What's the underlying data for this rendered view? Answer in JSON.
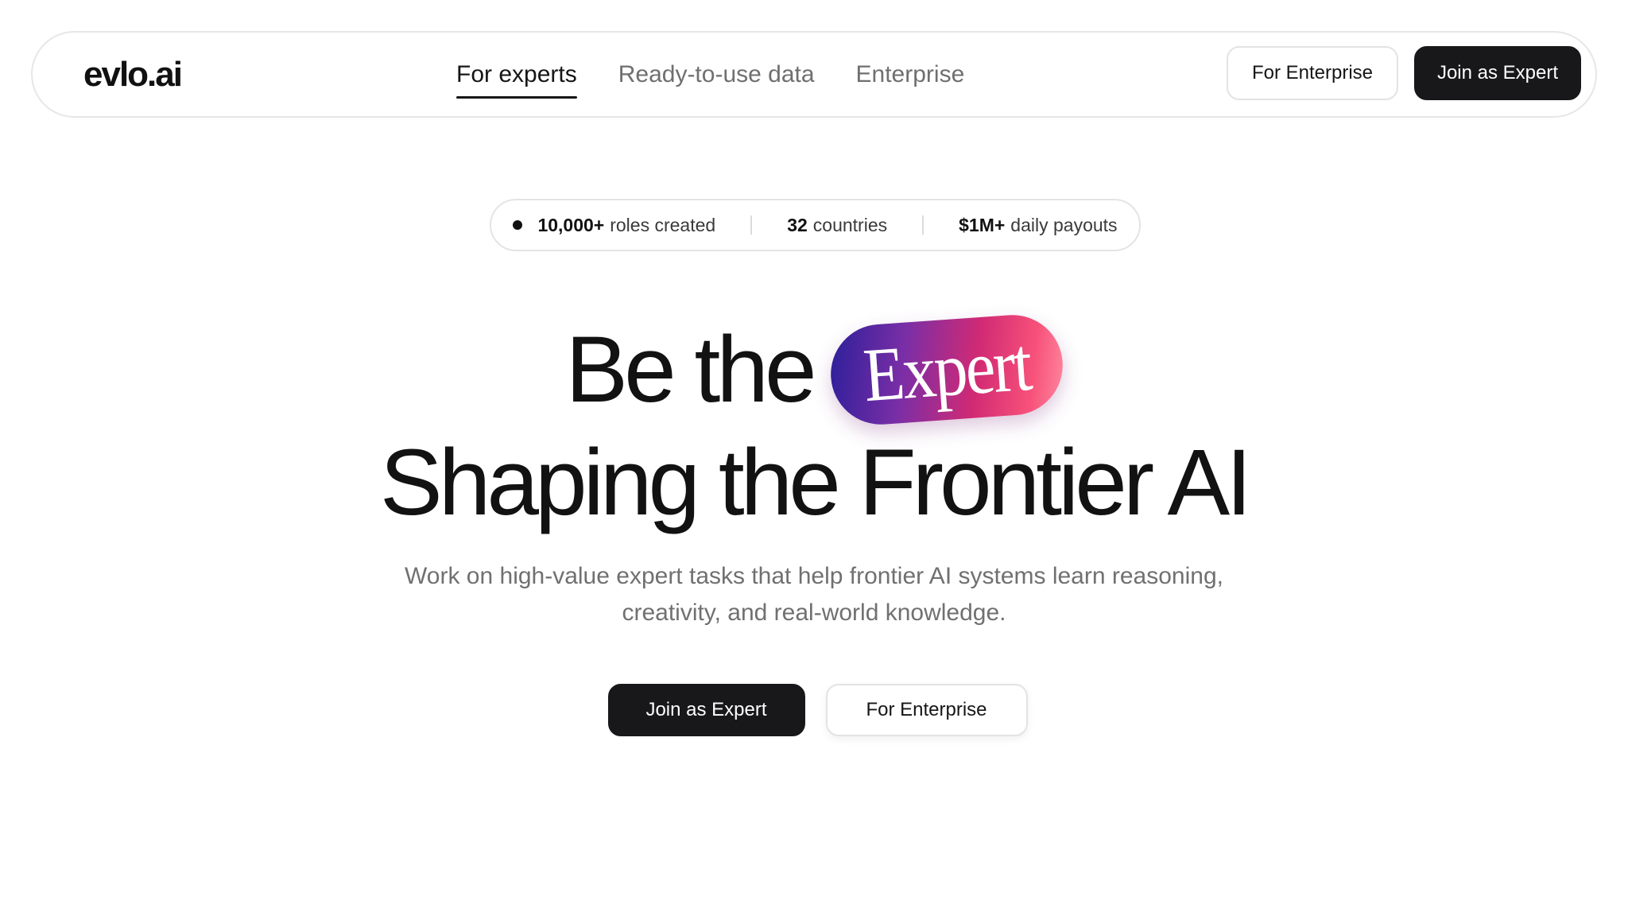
{
  "nav": {
    "logo": "evlo.ai",
    "links": [
      {
        "label": "For experts",
        "active": true
      },
      {
        "label": "Ready-to-use data",
        "active": false
      },
      {
        "label": "Enterprise",
        "active": false
      }
    ],
    "enterprise_button": "For Enterprise",
    "join_button": "Join as Expert"
  },
  "stats": {
    "roles_value": "10,000+",
    "roles_label": "roles created",
    "countries_value": "32",
    "countries_label": "countries",
    "payouts_value": "$1M+",
    "payouts_label": "daily payouts"
  },
  "hero": {
    "line1_prefix": "Be the",
    "badge": "Expert",
    "line2": "Shaping the Frontier AI",
    "subtitle_line1": "Work on high-value expert tasks that help frontier AI systems learn reasoning,",
    "subtitle_line2": "creativity, and real-world knowledge.",
    "primary_cta": "Join as Expert",
    "secondary_cta": "For Enterprise"
  },
  "colors": {
    "primary_dark": "#18181a",
    "muted_text": "#707070",
    "border": "#e4e4e4",
    "badge_gradient_start": "#2a1f9a",
    "badge_gradient_end": "#ff8ca0"
  }
}
